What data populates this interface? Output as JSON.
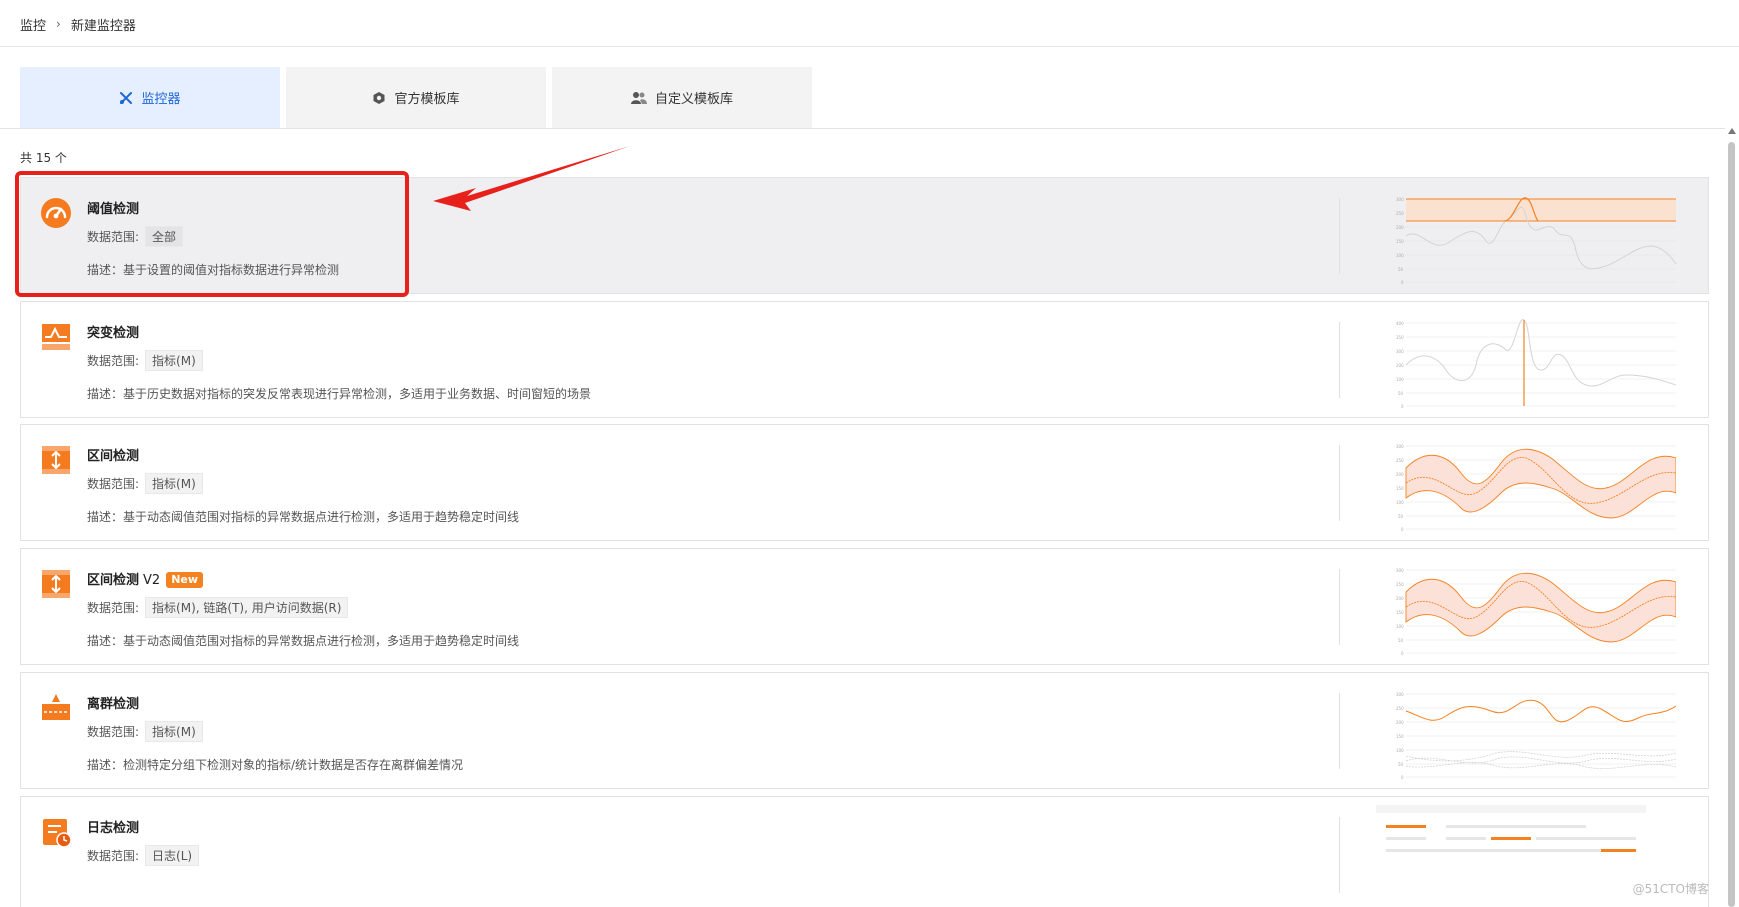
{
  "breadcrumb": {
    "root": "监控",
    "current": "新建监控器"
  },
  "tabs": [
    {
      "label": "监控器",
      "icon": "monitor-tools-icon"
    },
    {
      "label": "官方模板库",
      "icon": "hexagon-template-icon"
    },
    {
      "label": "自定义模板库",
      "icon": "users-icon"
    }
  ],
  "total_text": "共 15 个",
  "scope_label": "数据范围:",
  "colors": {
    "accent": "#f58220",
    "tab_active_bg": "#e6efff",
    "tab_active_text": "#1d66d8",
    "highlight": "#e8201c"
  },
  "cards": [
    {
      "title": "阈值检测",
      "scope": "全部",
      "desc": "描述：基于设置的阈值对指标数据进行异常检测",
      "icon": "gauge-icon"
    },
    {
      "title": "突变检测",
      "scope": "指标(M)",
      "desc": "描述：基于历史数据对指标的突发反常表现进行异常检测，多适用于业务数据、时间窗短的场景",
      "icon": "spike-chart-icon"
    },
    {
      "title": "区间检测",
      "scope": "指标(M)",
      "desc": "描述：基于动态阈值范围对指标的异常数据点进行检测，多适用于趋势稳定时间线",
      "icon": "range-arrows-icon"
    },
    {
      "title": "区间检测",
      "title_suffix": "V2",
      "badge": "New",
      "scope": "指标(M), 链路(T), 用户访问数据(R)",
      "desc": "描述：基于动态阈值范围对指标的异常数据点进行检测，多适用于趋势稳定时间线",
      "icon": "range-arrows-icon"
    },
    {
      "title": "离群检测",
      "scope": "指标(M)",
      "desc": "描述：检测特定分组下检测对象的指标/统计数据是否存在离群偏差情况",
      "icon": "outlier-icon"
    },
    {
      "title": "日志检测",
      "scope": "日志(L)",
      "desc": "",
      "icon": "log-clock-icon"
    }
  ],
  "watermark": "@51CTO博客"
}
